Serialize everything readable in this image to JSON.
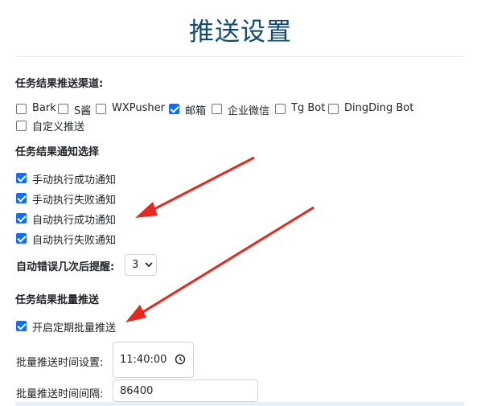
{
  "page": {
    "title": "推送设置"
  },
  "channels": {
    "label": "任务结果推送渠道:",
    "items": [
      {
        "label": "Bark",
        "checked": false
      },
      {
        "label": "S酱",
        "checked": false
      },
      {
        "label": "WXPusher",
        "checked": false
      },
      {
        "label": "邮箱",
        "checked": true
      },
      {
        "label": "企业微信",
        "checked": false
      },
      {
        "label": "Tg Bot",
        "checked": false
      },
      {
        "label": "DingDing Bot",
        "checked": false
      },
      {
        "label": "自定义推送",
        "checked": false
      }
    ]
  },
  "notify": {
    "label": "任务结果通知选择",
    "items": [
      {
        "label": "手动执行成功通知",
        "checked": true
      },
      {
        "label": "手动执行失败通知",
        "checked": true
      },
      {
        "label": "自动执行成功通知",
        "checked": true
      },
      {
        "label": "自动执行失败通知",
        "checked": true
      }
    ],
    "error_label": "自动错误几次后提醒:",
    "error_value": "3"
  },
  "batch": {
    "label": "任务结果批量推送",
    "enable_label": "开启定期批量推送",
    "enable_checked": true,
    "time_label": "批量推送时间设置:",
    "time_value": "11:40:00",
    "interval_label": "批量推送时间间隔:",
    "interval_value": "86400"
  },
  "colors": {
    "accent": "#0d6efd",
    "title": "#0d4a77",
    "arrow": "#e8281f"
  }
}
